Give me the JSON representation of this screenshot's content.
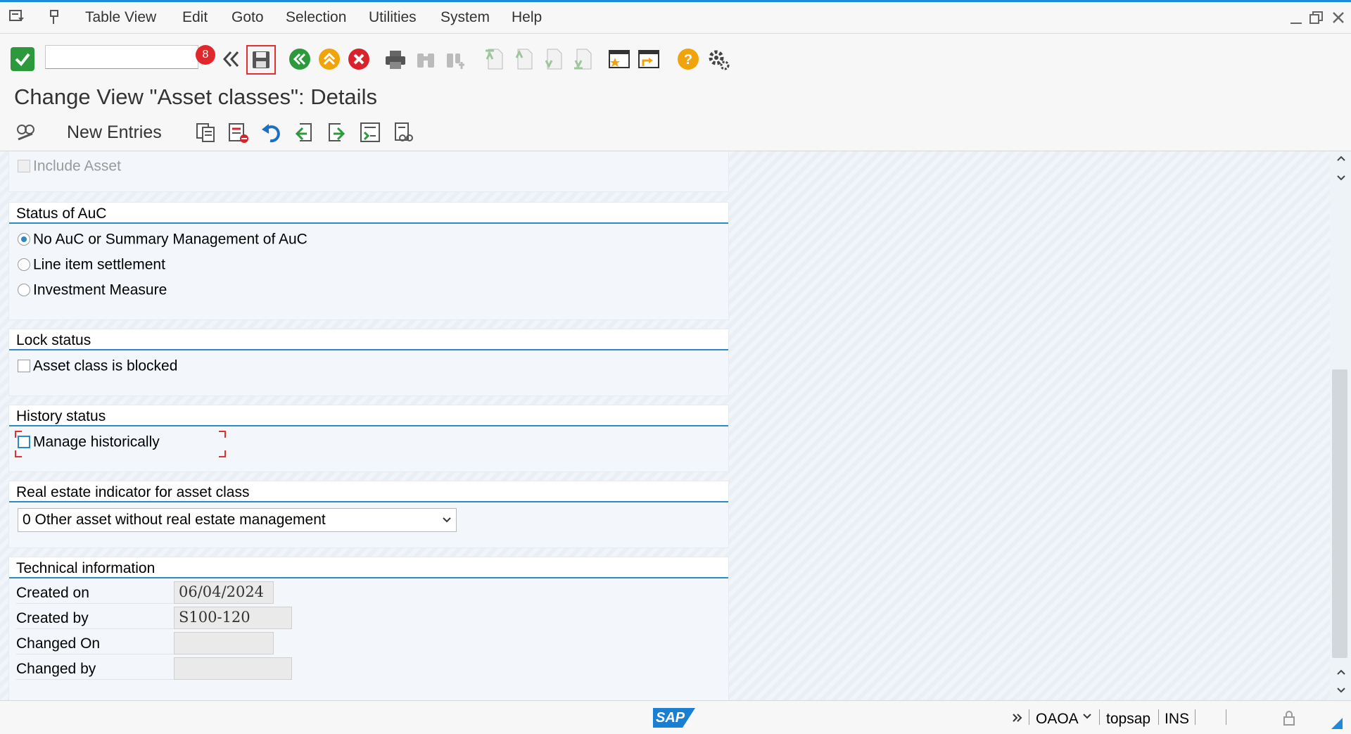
{
  "menu": {
    "items": [
      "Table View",
      "Edit",
      "Goto",
      "Selection",
      "Utilities",
      "System",
      "Help"
    ]
  },
  "toolbar": {
    "command_value": "",
    "badge": "8"
  },
  "title": "Change View \"Asset classes\": Details",
  "app_toolbar": {
    "new_entries": "New Entries"
  },
  "groups": {
    "include": {
      "label": "Include Asset",
      "checked": false
    },
    "auc": {
      "title": "Status of AuC",
      "options": [
        {
          "label": "No AuC or Summary Management of AuC",
          "selected": true
        },
        {
          "label": "Line item settlement",
          "selected": false
        },
        {
          "label": "Investment Measure",
          "selected": false
        }
      ]
    },
    "lock": {
      "title": "Lock status",
      "label": "Asset class is blocked",
      "checked": false
    },
    "history": {
      "title": "History status",
      "label": "Manage historically",
      "checked": false
    },
    "realestate": {
      "title": "Real estate indicator for asset class",
      "value": "0 Other asset without real estate management"
    },
    "tech": {
      "title": "Technical information",
      "rows": [
        {
          "label": "Created on",
          "value": "06/04/2024"
        },
        {
          "label": "Created by",
          "value": "S100-120"
        },
        {
          "label": "Changed On",
          "value": ""
        },
        {
          "label": "Changed by",
          "value": ""
        }
      ]
    }
  },
  "status": {
    "system": "OAOA",
    "user": "topsap",
    "mode": "INS",
    "logo": "SAP"
  },
  "colors": {
    "accent": "#2d87c8",
    "topline": "#1f8ad8",
    "badge": "#e0272b"
  }
}
